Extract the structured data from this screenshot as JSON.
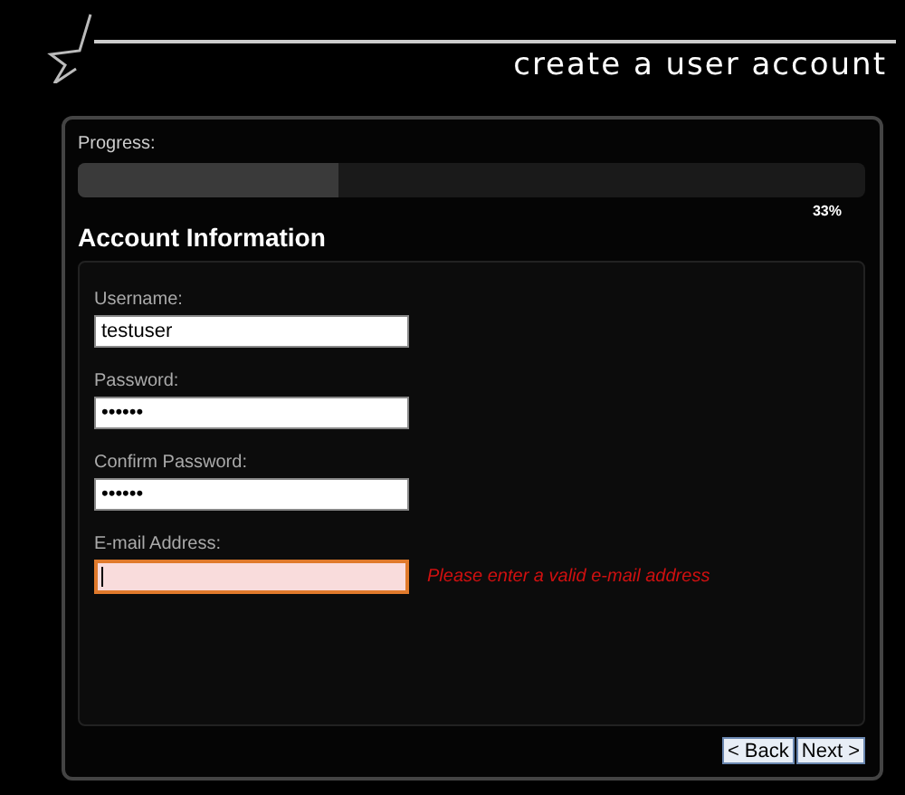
{
  "header": {
    "title": "create a user account"
  },
  "progress": {
    "label": "Progress:",
    "level": 0.33,
    "reading": "33%"
  },
  "section": {
    "title": "Account Information"
  },
  "fields": [
    {
      "label": "Username:",
      "value": "testuser",
      "invalid": false,
      "focused": false
    },
    {
      "label": "Password:",
      "value": "••••••",
      "invalid": false,
      "focused": false
    },
    {
      "label": "Confirm Password:",
      "value": "••••••",
      "invalid": false,
      "focused": false
    },
    {
      "label": "E-mail Address:",
      "invalid": true,
      "focused": true,
      "error": "Please enter a valid e-mail address"
    }
  ],
  "buttons": [
    {
      "label": "< Back"
    },
    {
      "label": "Next >"
    }
  ]
}
